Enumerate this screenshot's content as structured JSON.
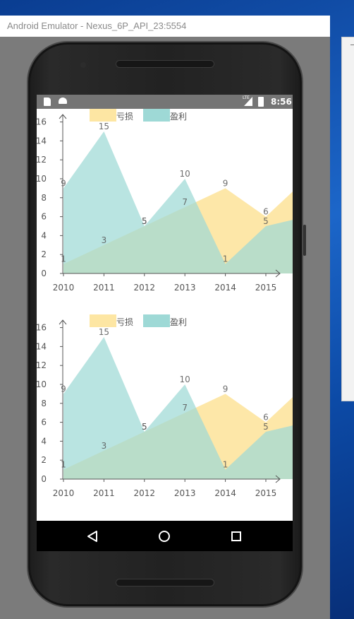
{
  "emulator": {
    "title": "Android Emulator - Nexus_6P_API_23:5554"
  },
  "status_bar": {
    "time": "8:56",
    "network": "LTE",
    "icons": [
      "sd-card-icon",
      "android-debug-icon",
      "signal-icon",
      "battery-charging-icon"
    ]
  },
  "nav_bar": {
    "buttons": [
      "back-icon",
      "home-icon",
      "recents-icon"
    ]
  },
  "colors": {
    "loss": "#fde6a3",
    "profit": "#9ed9d6",
    "overlap": "#9ccfae",
    "axis": "#555555",
    "text": "#555555"
  },
  "chart_data": [
    {
      "type": "area",
      "categories": [
        "2010",
        "2011",
        "2012",
        "2013",
        "2014",
        "2015"
      ],
      "ylim": [
        0,
        16
      ],
      "yticks": [
        "0",
        "2",
        "4",
        "6",
        "8",
        "10",
        "12",
        "14",
        "16"
      ],
      "legend_position": "top",
      "series": [
        {
          "name": "亏损",
          "color": "#fde6a3",
          "values": [
            1,
            3,
            5,
            7,
            9,
            6,
            10
          ],
          "labels": [
            "1",
            "3",
            "5",
            "7",
            "9",
            "6",
            ""
          ]
        },
        {
          "name": "盈利",
          "color": "#9ed9d6",
          "values": [
            9,
            15,
            5,
            10,
            1,
            5,
            6
          ],
          "labels": [
            "9",
            "15",
            "5",
            "10",
            "1",
            "5",
            ""
          ]
        }
      ]
    },
    {
      "type": "area",
      "categories": [
        "2010",
        "2011",
        "2012",
        "2013",
        "2014",
        "2015"
      ],
      "ylim": [
        0,
        16
      ],
      "yticks": [
        "0",
        "2",
        "4",
        "6",
        "8",
        "10",
        "12",
        "14",
        "16"
      ],
      "legend_position": "top",
      "series": [
        {
          "name": "亏损",
          "color": "#fde6a3",
          "values": [
            1,
            3,
            5,
            7,
            9,
            6,
            10
          ],
          "labels": [
            "1",
            "3",
            "5",
            "7",
            "9",
            "6",
            ""
          ]
        },
        {
          "name": "盈利",
          "color": "#9ed9d6",
          "values": [
            9,
            15,
            5,
            10,
            1,
            5,
            6
          ],
          "labels": [
            "9",
            "15",
            "5",
            "10",
            "1",
            "5",
            ""
          ]
        }
      ]
    }
  ]
}
